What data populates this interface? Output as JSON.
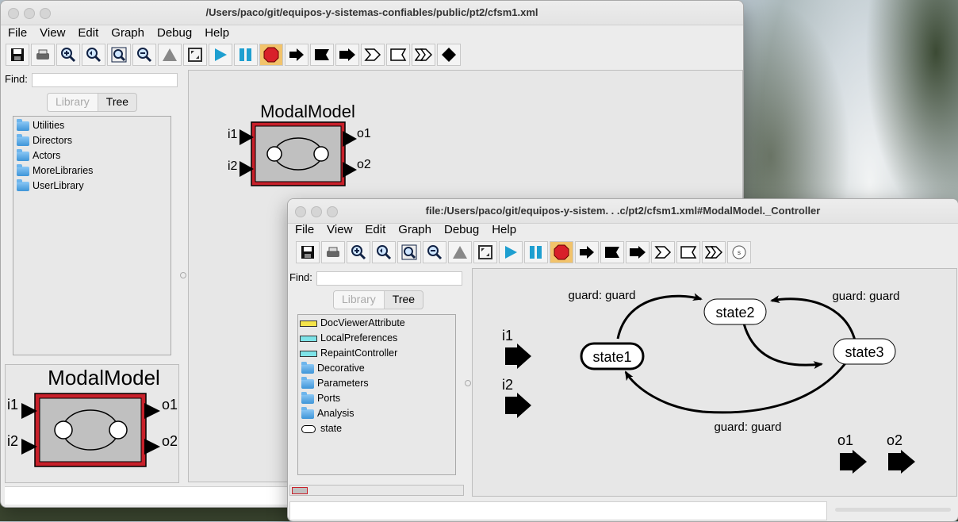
{
  "main_window": {
    "title": "/Users/paco/git/equipos-y-sistemas-confiables/public/pt2/cfsm1.xml",
    "menu": [
      "File",
      "View",
      "Edit",
      "Graph",
      "Debug",
      "Help"
    ],
    "find_label": "Find:",
    "find_value": "",
    "tabs": {
      "library": "Library",
      "tree": "Tree"
    },
    "library_items": [
      "Utilities",
      "Directors",
      "Actors",
      "MoreLibraries",
      "UserLibrary"
    ],
    "actor": {
      "name": "ModalModel",
      "inputs": [
        "i1",
        "i2"
      ],
      "outputs": [
        "o1",
        "o2"
      ]
    },
    "preview": {
      "name": "ModalModel",
      "inputs": [
        "i1",
        "i2"
      ],
      "outputs": [
        "o1",
        "o2"
      ]
    }
  },
  "toolbar_icons": [
    "save-icon",
    "print-icon",
    "zoom-in-icon",
    "zoom-reset-icon",
    "zoom-fit-icon",
    "zoom-out-icon",
    "arrange-icon",
    "fullscreen-icon",
    "run-icon",
    "pause-icon",
    "stop-icon",
    "arrow-right-icon",
    "arrow-flag-icon",
    "arrow-filled-icon",
    "arrow-open-icon",
    "arrow-open-flag-icon",
    "arrow-double-open-icon",
    "diamond-icon"
  ],
  "controller_window": {
    "title": "file:/Users/paco/git/equipos-y-sistem. . .c/pt2/cfsm1.xml#ModalModel._Controller",
    "menu": [
      "File",
      "View",
      "Edit",
      "Graph",
      "Debug",
      "Help"
    ],
    "find_label": "Find:",
    "find_value": "",
    "tabs": {
      "library": "Library",
      "tree": "Tree"
    },
    "library_items": [
      {
        "label": "DocViewerAttribute",
        "icon": "attribute-yellow-icon"
      },
      {
        "label": "LocalPreferences",
        "icon": "attribute-cyan-icon"
      },
      {
        "label": "RepaintController",
        "icon": "attribute-cyan-icon"
      },
      {
        "label": "Decorative",
        "icon": "folder-icon"
      },
      {
        "label": "Parameters",
        "icon": "folder-icon"
      },
      {
        "label": "Ports",
        "icon": "folder-icon"
      },
      {
        "label": "Analysis",
        "icon": "folder-icon"
      },
      {
        "label": "state",
        "icon": "state-icon"
      }
    ],
    "fsm": {
      "states": [
        "state1",
        "state2",
        "state3"
      ],
      "inputs": [
        "i1",
        "i2"
      ],
      "outputs": [
        "o1",
        "o2"
      ],
      "transitions": [
        {
          "from": "state1",
          "to": "state2",
          "label": "guard: guard"
        },
        {
          "from": "state3",
          "to": "state2",
          "label": "guard: guard"
        },
        {
          "from": "state2",
          "to": "state3",
          "label": ""
        },
        {
          "from": "state3",
          "to": "state1",
          "label": "guard: guard"
        }
      ]
    }
  },
  "colors": {
    "actor_border": "#c8202a",
    "actor_fill": "#c0c0c0",
    "run": "#1e9fd0",
    "stop": "#d8202a",
    "toolbar_hot": "#f2c36b"
  }
}
